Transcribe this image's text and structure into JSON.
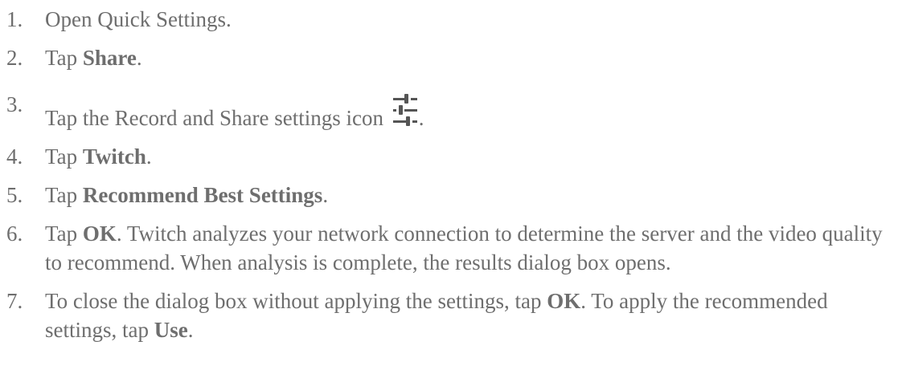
{
  "steps": [
    {
      "number": "1.",
      "parts": [
        {
          "text": "Open Quick Settings."
        }
      ]
    },
    {
      "number": "2.",
      "parts": [
        {
          "text": "Tap "
        },
        {
          "text": "Share",
          "bold": true
        },
        {
          "text": "."
        }
      ]
    },
    {
      "number": "3.",
      "parts": [
        {
          "text": "Tap the Record and Share settings icon "
        },
        {
          "icon": "sliders-settings-icon"
        },
        {
          "text": "."
        }
      ]
    },
    {
      "number": "4.",
      "parts": [
        {
          "text": "Tap "
        },
        {
          "text": "Twitch",
          "bold": true
        },
        {
          "text": "."
        }
      ]
    },
    {
      "number": "5.",
      "parts": [
        {
          "text": "Tap "
        },
        {
          "text": "Recommend Best Settings",
          "bold": true
        },
        {
          "text": "."
        }
      ]
    },
    {
      "number": "6.",
      "parts": [
        {
          "text": "Tap "
        },
        {
          "text": "OK",
          "bold": true
        },
        {
          "text": ". Twitch analyzes your network connection to determine the server and the video quality to recommend. When analysis is complete, the results dialog box opens."
        }
      ]
    },
    {
      "number": "7.",
      "parts": [
        {
          "text": "To close the dialog box without applying the settings, tap "
        },
        {
          "text": "OK",
          "bold": true
        },
        {
          "text": ". To apply the recommended settings, tap "
        },
        {
          "text": "Use",
          "bold": true
        },
        {
          "text": "."
        }
      ]
    }
  ],
  "colors": {
    "text": "#6e6e6e",
    "icon": "#555555"
  }
}
